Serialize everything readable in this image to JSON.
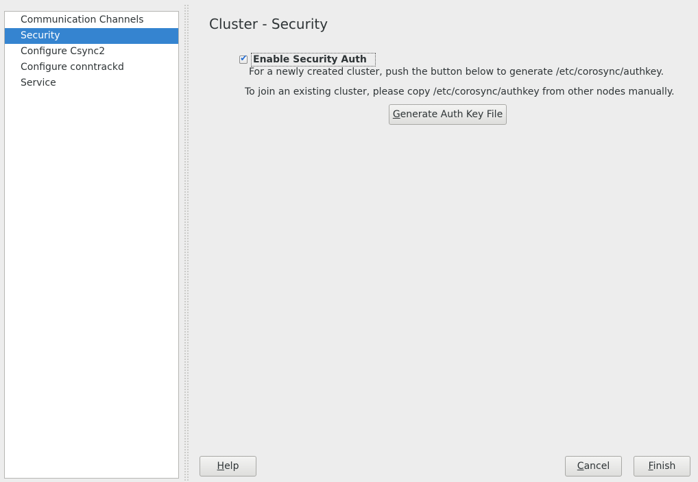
{
  "sidebar": {
    "items": [
      {
        "label": "Communication Channels",
        "selected": false
      },
      {
        "label": "Security",
        "selected": true
      },
      {
        "label": "Configure Csync2",
        "selected": false
      },
      {
        "label": "Configure conntrackd",
        "selected": false
      },
      {
        "label": "Service",
        "selected": false
      }
    ]
  },
  "main": {
    "title": "Cluster - Security",
    "enable_auth": {
      "label": "Enable Security Auth",
      "checked": true
    },
    "help_text_1": "For a newly created cluster, push the button below to generate /etc/corosync/authkey.",
    "help_text_2": "To join an existing cluster, please copy /etc/corosync/authkey from other nodes manually.",
    "generate_button": {
      "mnemonic": "G",
      "rest": "enerate Auth Key File"
    }
  },
  "footer": {
    "help_button": {
      "mnemonic": "H",
      "rest": "elp"
    },
    "cancel_button": {
      "mnemonic": "C",
      "rest": "ancel"
    },
    "finish_button": {
      "mnemonic": "F",
      "rest": "inish"
    }
  },
  "colors": {
    "selection": "#3584d0",
    "background": "#ededed",
    "checkmark": "#2a6fd0"
  }
}
